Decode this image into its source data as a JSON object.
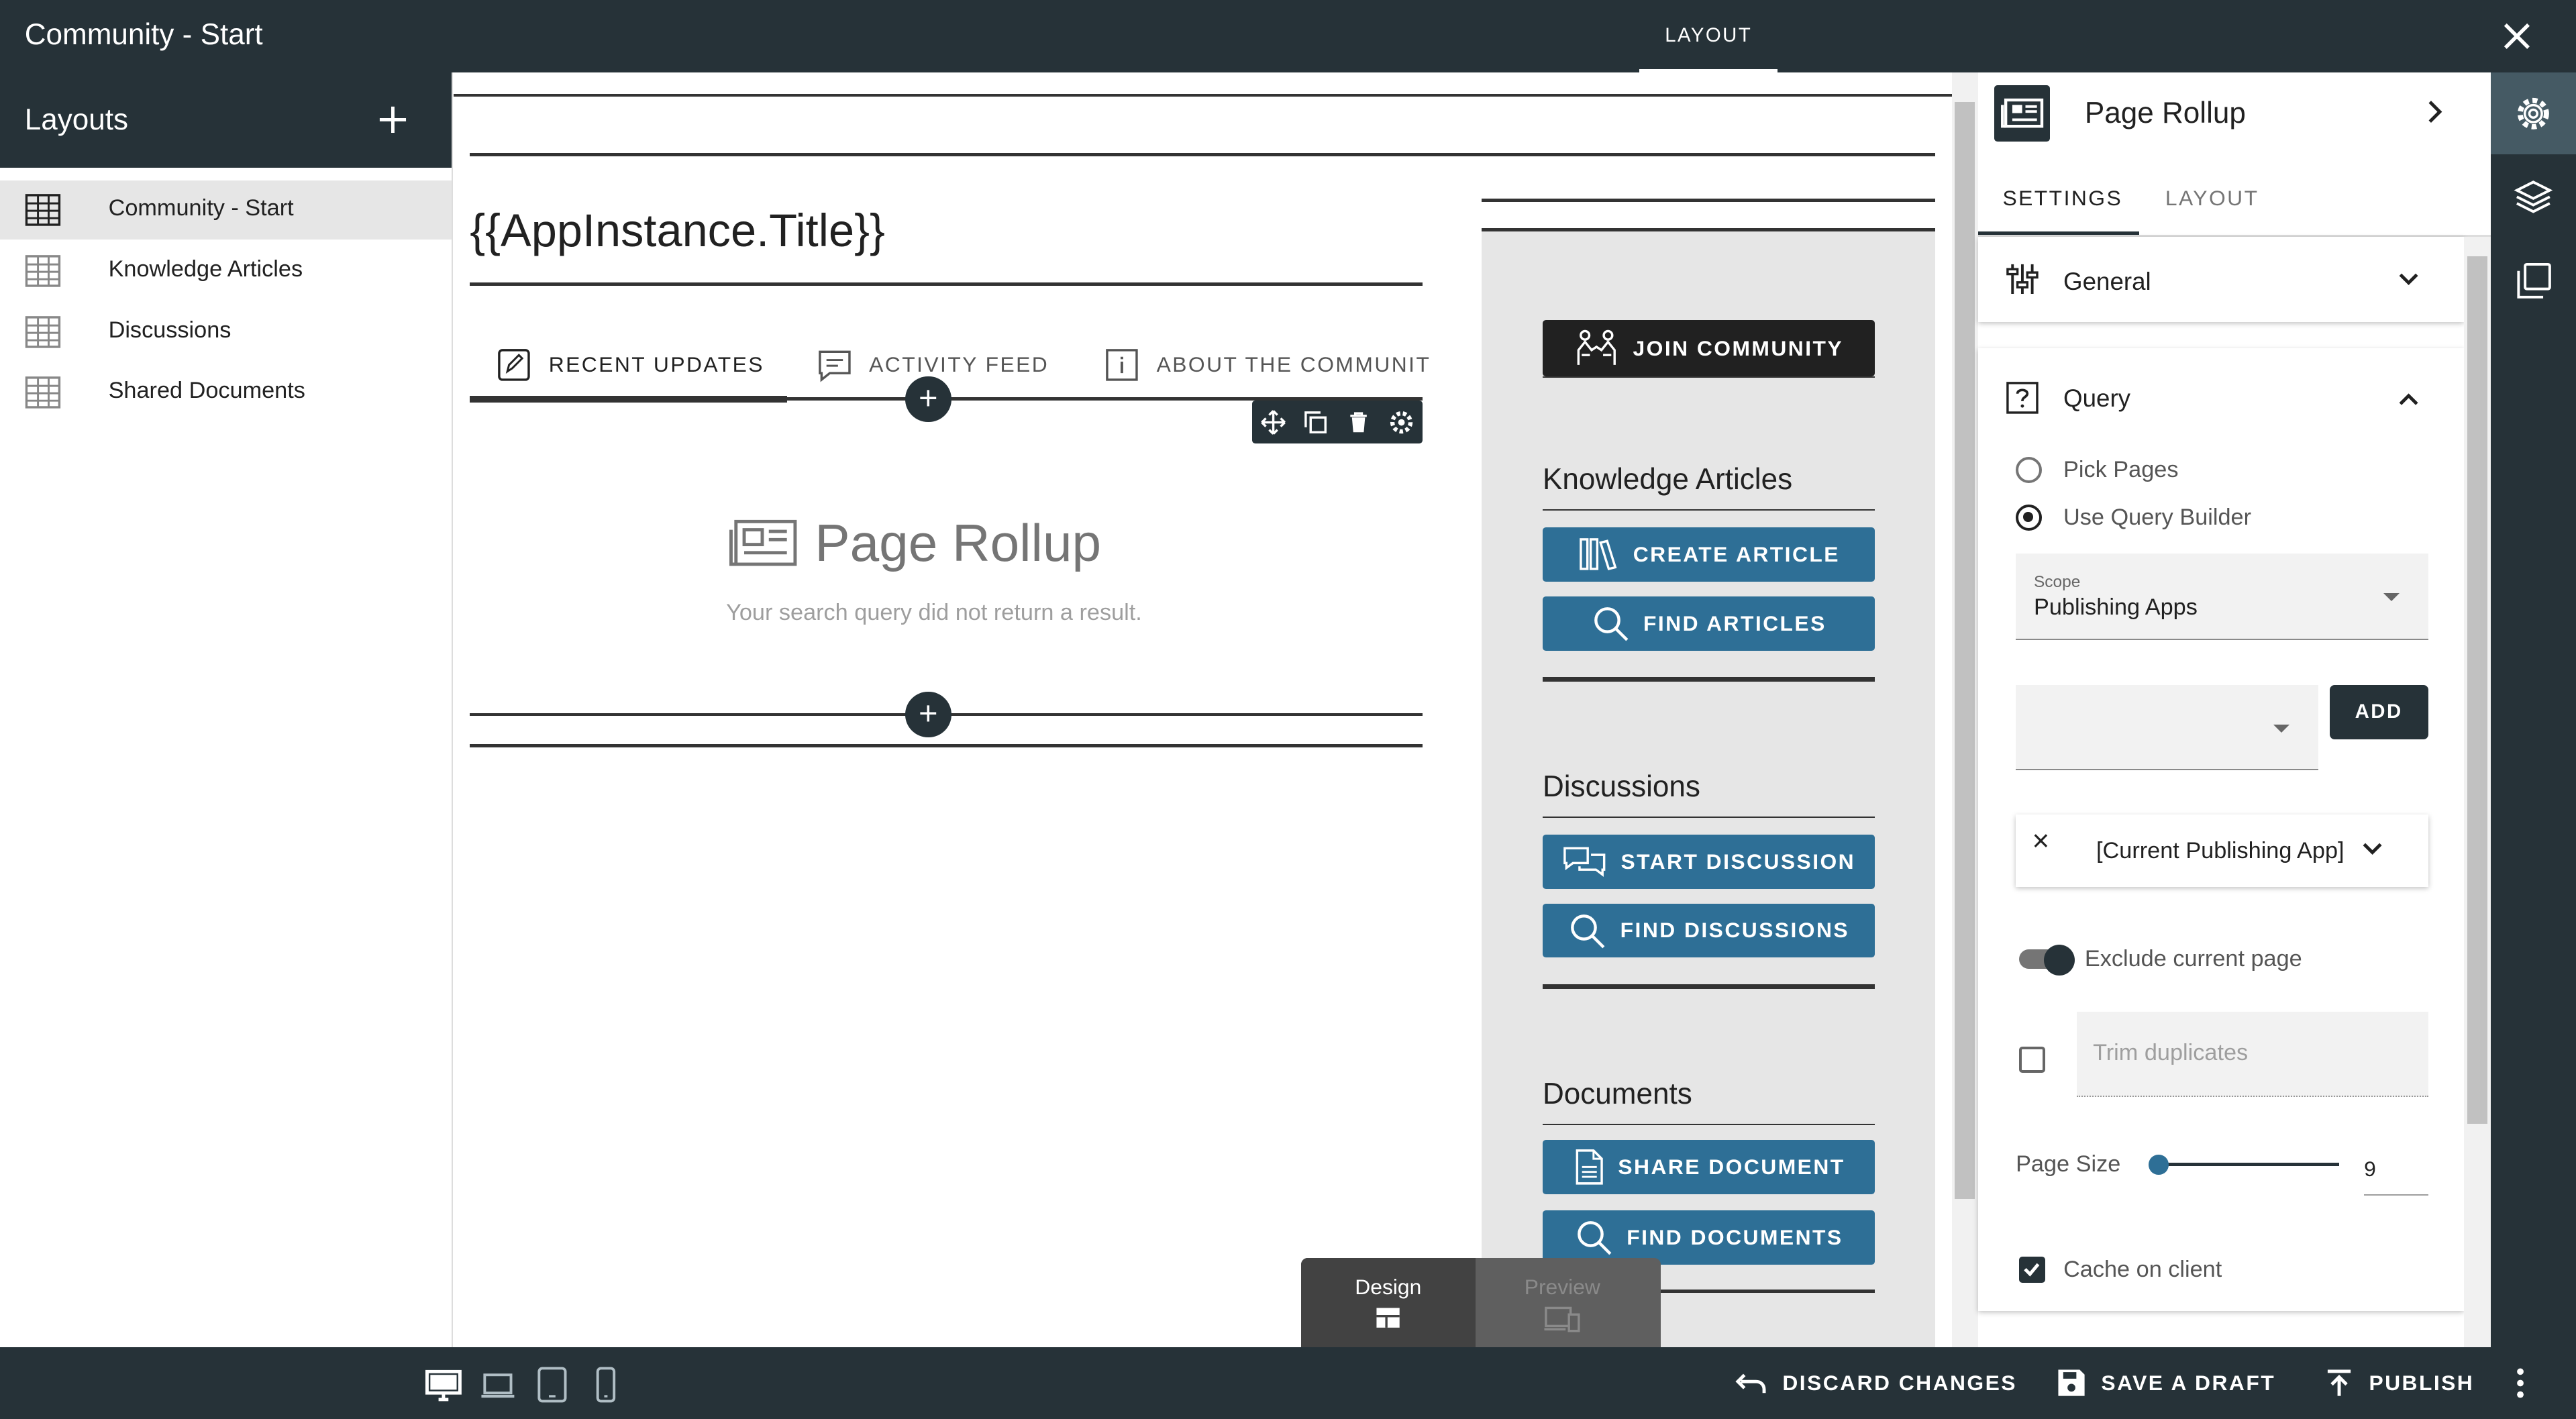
{
  "app": {
    "title": "Community - Start",
    "top_tab": "LAYOUT"
  },
  "layouts_panel": {
    "title": "Layouts",
    "items": [
      {
        "label": "Community - Start",
        "selected": true
      },
      {
        "label": "Knowledge Articles"
      },
      {
        "label": "Discussions"
      },
      {
        "label": "Shared Documents"
      }
    ]
  },
  "canvas": {
    "heading": "{{AppInstance.Title}}",
    "tabs": [
      "RECENT UPDATES",
      "ACTIVITY FEED",
      "ABOUT THE COMMUNIT"
    ],
    "add_symbol": "+",
    "rollup": {
      "title": "Page Rollup",
      "message": "Your search query did not return a result."
    },
    "sidebar": {
      "join_button": "JOIN COMMUNITY",
      "sections": [
        {
          "title": "Knowledge Articles",
          "buttons": [
            "CREATE ARTICLE",
            "FIND ARTICLES"
          ]
        },
        {
          "title": "Discussions",
          "buttons": [
            "START DISCUSSION",
            "FIND DISCUSSIONS"
          ]
        },
        {
          "title": "Documents",
          "buttons": [
            "SHARE DOCUMENT",
            "FIND DOCUMENTS"
          ]
        }
      ]
    },
    "view_switch": {
      "design": "Design",
      "preview": "Preview"
    }
  },
  "properties_panel": {
    "title": "Page Rollup",
    "tabs": [
      "SETTINGS",
      "LAYOUT"
    ],
    "general": "General",
    "query": {
      "title": "Query",
      "option_pick": "Pick Pages",
      "option_builder": "Use Query Builder",
      "selected_option": "Use Query Builder",
      "scope_caption": "Scope",
      "scope_value": "Publishing Apps",
      "add_label": "ADD",
      "chip_close": "×",
      "chip_label": "[Current Publishing App]",
      "exclude_label": "Exclude current page",
      "exclude_on": true,
      "trim_placeholder": "Trim duplicates",
      "trim_checked": false,
      "page_size_label": "Page Size",
      "page_size_value": "9",
      "cache_label": "Cache on client",
      "cache_checked": true
    }
  },
  "bottom_bar": {
    "discard": "DISCARD CHANGES",
    "save": "SAVE A DRAFT",
    "publish": "PUBLISH"
  }
}
